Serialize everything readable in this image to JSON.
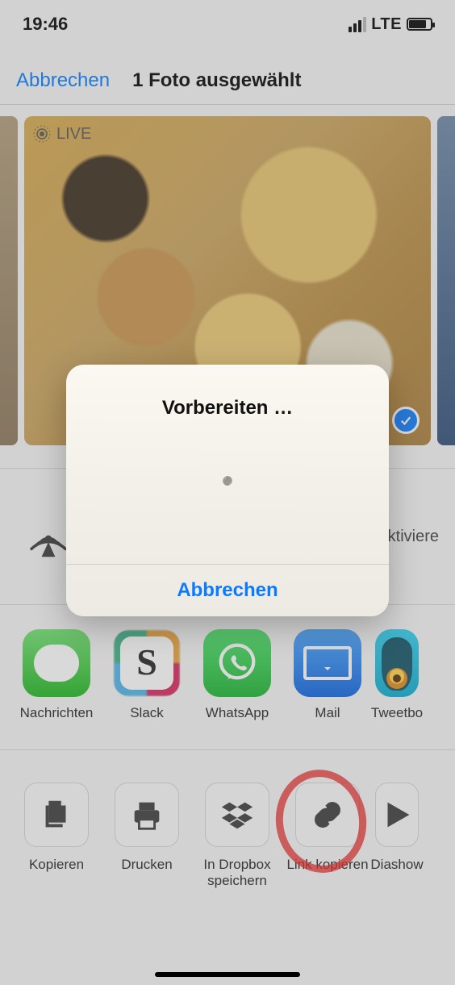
{
  "statusbar": {
    "time": "19:46",
    "network": "LTE"
  },
  "header": {
    "cancel": "Abbrechen",
    "title": "1 Foto ausgewählt"
  },
  "photo": {
    "live_badge": "LIVE"
  },
  "airdrop": {
    "truncated_text": "aktiviere"
  },
  "apps": [
    {
      "id": "messages",
      "label": "Nachrichten"
    },
    {
      "id": "slack",
      "label": "Slack"
    },
    {
      "id": "whatsapp",
      "label": "WhatsApp"
    },
    {
      "id": "mail",
      "label": "Mail"
    },
    {
      "id": "tweetbot",
      "label": "Tweetbo"
    }
  ],
  "actions": [
    {
      "id": "copy",
      "label": "Kopieren"
    },
    {
      "id": "print",
      "label": "Drucken"
    },
    {
      "id": "dropbox",
      "label": "In Dropbox speichern"
    },
    {
      "id": "copylink",
      "label": "Link kopieren"
    },
    {
      "id": "slideshow",
      "label": "Diashow"
    }
  ],
  "modal": {
    "title": "Vorbereiten …",
    "cancel": "Abbrechen"
  }
}
